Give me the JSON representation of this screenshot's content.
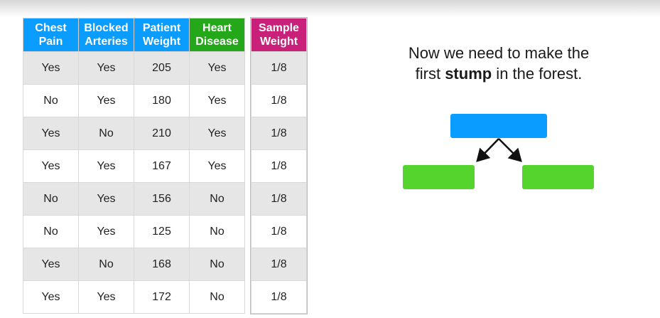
{
  "table": {
    "headers": [
      {
        "line1": "Chest",
        "line2": "Pain",
        "color": "#0a9cff"
      },
      {
        "line1": "Blocked",
        "line2": "Arteries",
        "color": "#0a9cff"
      },
      {
        "line1": "Patient",
        "line2": "Weight",
        "color": "#0a9cff"
      },
      {
        "line1": "Heart",
        "line2": "Disease",
        "color": "#24a81a"
      }
    ],
    "rows": [
      [
        "Yes",
        "Yes",
        "205",
        "Yes"
      ],
      [
        "No",
        "Yes",
        "180",
        "Yes"
      ],
      [
        "Yes",
        "No",
        "210",
        "Yes"
      ],
      [
        "Yes",
        "Yes",
        "167",
        "Yes"
      ],
      [
        "No",
        "Yes",
        "156",
        "No"
      ],
      [
        "No",
        "Yes",
        "125",
        "No"
      ],
      [
        "Yes",
        "No",
        "168",
        "No"
      ],
      [
        "Yes",
        "Yes",
        "172",
        "No"
      ]
    ]
  },
  "weights": {
    "header": {
      "line1": "Sample",
      "line2": "Weight",
      "color": "#c9217a"
    },
    "values": [
      "1/8",
      "1/8",
      "1/8",
      "1/8",
      "1/8",
      "1/8",
      "1/8",
      "1/8"
    ]
  },
  "caption": {
    "line1": "Now we need to make the",
    "line2_before": "first ",
    "line2_bold": "stump",
    "line2_after": " in the forest."
  },
  "colors": {
    "root_node": "#0a9cff",
    "leaf_node": "#55d42e",
    "arrow": "#111111"
  }
}
